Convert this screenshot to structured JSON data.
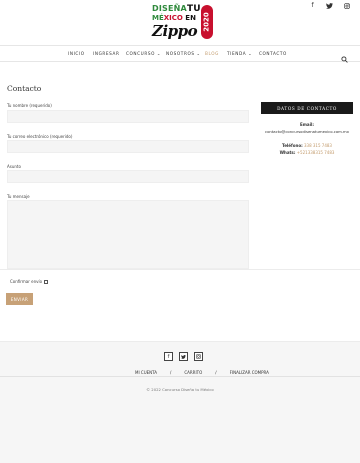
{
  "header": {
    "logo": {
      "line1_a": "DISEÑA",
      "line1_b": "TU",
      "line2_a": "MÉ",
      "line2_b": "XICO",
      "line2_c": "EN",
      "line3": "Zippo",
      "year": "2020"
    },
    "social": [
      {
        "icon": "facebook-icon",
        "glyph": "f"
      },
      {
        "icon": "twitter-icon",
        "glyph": "🐦"
      },
      {
        "icon": "instagram-icon",
        "glyph": "◎"
      }
    ]
  },
  "nav": {
    "items": [
      {
        "label": "INICIO",
        "active": false
      },
      {
        "label": "INGRESAR",
        "active": false
      },
      {
        "label": "CONCURSO ⌄",
        "active": false
      },
      {
        "label": "NOSOTROS ⌄",
        "active": false
      },
      {
        "label": "BLOG",
        "active": true
      },
      {
        "label": "TIENDA ⌄",
        "active": false
      },
      {
        "label": "CONTACTO",
        "active": false
      }
    ],
    "search_icon": "search-icon"
  },
  "main": {
    "title": "Contacto",
    "fields": [
      {
        "label": "Tu nombre (requerido)",
        "value": ""
      },
      {
        "label": "Tu correo electrónico (requerido)",
        "value": ""
      },
      {
        "label": "Asunto",
        "value": ""
      },
      {
        "label": "Tu mensaje",
        "value": ""
      }
    ],
    "confirm_label": "Confirmar envío",
    "send_label": "ENVIAR"
  },
  "sidebar": {
    "heading": "DATOS DE CONTACTO",
    "email_label": "Email:",
    "email_value": "contacto@concursodisenatumexico.com.mx",
    "phone_label": "Teléfono:",
    "phone_value": "338 315 7483",
    "whats_label": "Whats:",
    "whats_value": "+521338315 7483"
  },
  "footer": {
    "social": [
      {
        "icon": "facebook-icon",
        "glyph": "f"
      },
      {
        "icon": "twitter-icon",
        "glyph": "🐦"
      },
      {
        "icon": "instagram-icon",
        "glyph": "◎"
      }
    ],
    "links": [
      "MI CUENTA",
      "/",
      "CARRITO",
      "/",
      "FINALIZAR COMPRA"
    ],
    "copyright": "© 2022 Concurso Diseña tu México"
  },
  "colors": {
    "accent": "#c29a6b",
    "button": "#c7a177",
    "sidebar_head": "#1a1a1a",
    "logo_green": "#2f8a3c",
    "logo_red": "#c8102e"
  }
}
